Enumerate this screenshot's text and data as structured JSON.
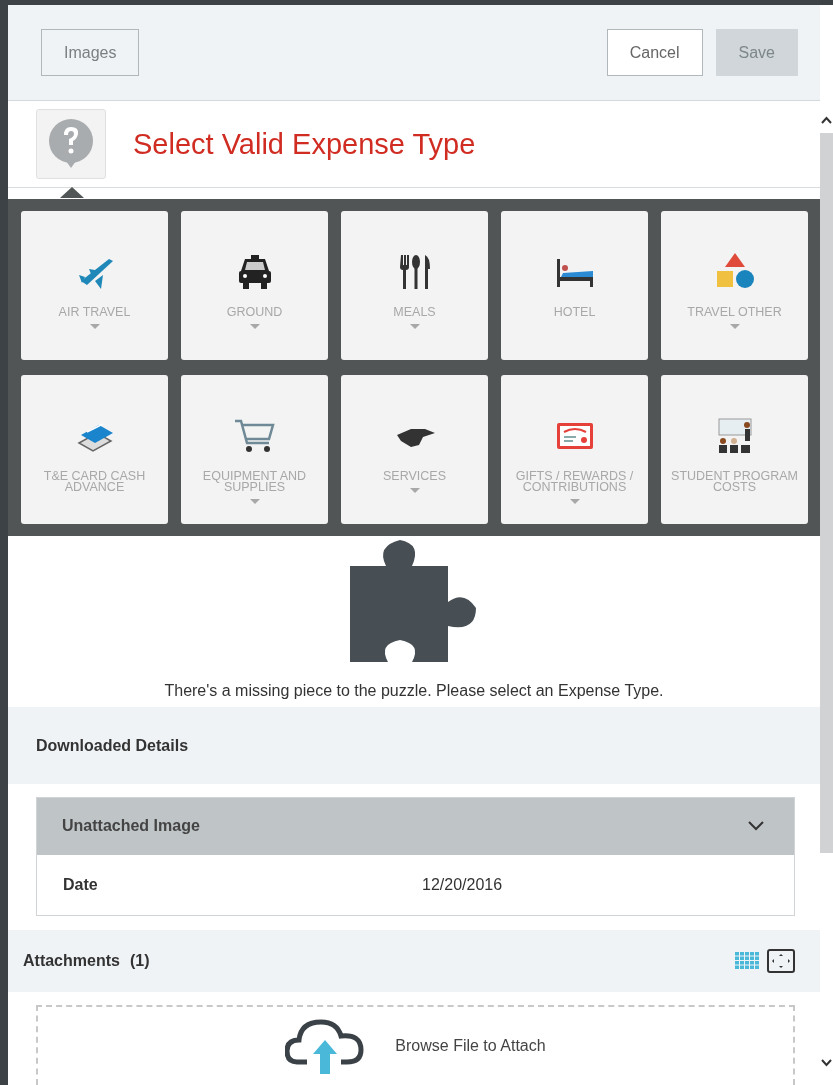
{
  "toolbar": {
    "images_button": "Images",
    "cancel_button": "Cancel",
    "save_button": {
      "label": "Save",
      "disabled": true
    }
  },
  "heading": "Select Valid Expense Type",
  "expense_types": [
    {
      "label": "AIR TRAVEL",
      "has_submenu": true
    },
    {
      "label": "GROUND",
      "has_submenu": true
    },
    {
      "label": "MEALS",
      "has_submenu": true
    },
    {
      "label": "HOTEL",
      "has_submenu": false
    },
    {
      "label": "TRAVEL OTHER",
      "has_submenu": true
    },
    {
      "label": "T&E CARD CASH ADVANCE",
      "has_submenu": false
    },
    {
      "label": "EQUIPMENT AND SUPPLIES",
      "has_submenu": true
    },
    {
      "label": "SERVICES",
      "has_submenu": true
    },
    {
      "label": "GIFTS / REWARDS / CONTRIBUTIONS",
      "has_submenu": true
    },
    {
      "label": "STUDENT PROGRAM COSTS",
      "has_submenu": false
    }
  ],
  "message": "There's a missing piece to the puzzle. Please select an Expense Type.",
  "downloaded_details": {
    "title": "Downloaded Details",
    "panel_title": "Unattached Image",
    "expanded": true,
    "rows": [
      {
        "label": "Date",
        "value": "12/20/2016"
      }
    ]
  },
  "attachments": {
    "title": "Attachments",
    "count": "(1)",
    "dropzone": "Browse File to Attach"
  }
}
